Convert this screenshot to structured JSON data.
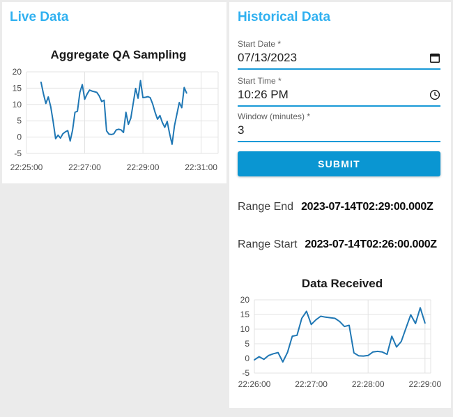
{
  "live_panel": {
    "title": "Live Data"
  },
  "historical_panel": {
    "title": "Historical Data",
    "fields": [
      {
        "label": "Start Date *",
        "value": "07/13/2023",
        "icon": "calendar-icon"
      },
      {
        "label": "Start Time *",
        "value": "10:26 PM",
        "icon": "clock-icon"
      },
      {
        "label": "Window (minutes) *",
        "value": "3",
        "icon": null
      }
    ],
    "submit_label": "SUBMIT",
    "results": [
      {
        "label": "Range End",
        "value": "2023-07-14T02:29:00.000Z"
      },
      {
        "label": "Range Start",
        "value": "2023-07-14T02:26:00.000Z"
      }
    ]
  },
  "colors": {
    "accent_blue": "#2fb0f0",
    "button_blue": "#0a96d2",
    "underline_blue": "#1899d7",
    "line_blue": "#1f77b4",
    "page_background": "#ebebeb",
    "grid_gray": "#e3e3e3"
  },
  "chart_data": [
    {
      "type": "line",
      "title": "Aggregate QA Sampling",
      "x_start": "22:25:30",
      "interval_seconds": 5,
      "values": [
        16.8,
        13.2,
        10.3,
        12.3,
        9.3,
        4.7,
        -0.5,
        0.6,
        -0.3,
        1.0,
        1.6,
        2.0,
        -1.2,
        2.1,
        7.6,
        7.9,
        13.7,
        16.1,
        11.6,
        13.2,
        14.4,
        14.1,
        13.9,
        13.7,
        12.6,
        10.9,
        11.3,
        1.9,
        0.9,
        0.8,
        1.0,
        2.2,
        2.4,
        2.2,
        1.4,
        7.6,
        3.9,
        5.8,
        10.4,
        14.9,
        11.9,
        17.3,
        12.1,
        12.2,
        12.4,
        12.1,
        10.2,
        7.6,
        5.5,
        6.6,
        4.5,
        3.0,
        4.8,
        1.0,
        -2.2,
        3.4,
        7.0,
        10.6,
        9.0,
        15.2,
        13.5
      ],
      "x_ticks": [
        "22:25:00",
        "22:27:00",
        "22:29:00",
        "22:31:00"
      ],
      "y_ticks": [
        20,
        15,
        10,
        5,
        0,
        -5
      ],
      "ylim": [
        -5,
        20
      ],
      "xlim": [
        "22:25:00",
        "22:31:35"
      ],
      "xlabel": "",
      "ylabel": "",
      "grid": true,
      "legend": "none",
      "line_color": "#1f77b4"
    },
    {
      "type": "line",
      "title": "Data Received",
      "x_start": "22:26:00",
      "interval_seconds": 5,
      "values": [
        -0.5,
        0.6,
        -0.3,
        1.0,
        1.6,
        2.0,
        -1.2,
        2.1,
        7.6,
        7.9,
        13.7,
        16.1,
        11.6,
        13.2,
        14.4,
        14.1,
        13.9,
        13.7,
        12.6,
        10.9,
        11.3,
        1.9,
        0.9,
        0.8,
        1.0,
        2.2,
        2.4,
        2.2,
        1.4,
        7.6,
        3.9,
        5.8,
        10.4,
        14.9,
        11.9,
        17.3,
        12.1
      ],
      "x_ticks": [
        "22:26:00",
        "22:27:00",
        "22:28:00",
        "22:29:00"
      ],
      "y_ticks": [
        20,
        15,
        10,
        5,
        0,
        -5
      ],
      "ylim": [
        -5,
        20
      ],
      "xlim": [
        "22:26:00",
        "22:29:06"
      ],
      "xlabel": "",
      "ylabel": "",
      "grid": true,
      "legend": "none",
      "line_color": "#1f77b4"
    }
  ]
}
